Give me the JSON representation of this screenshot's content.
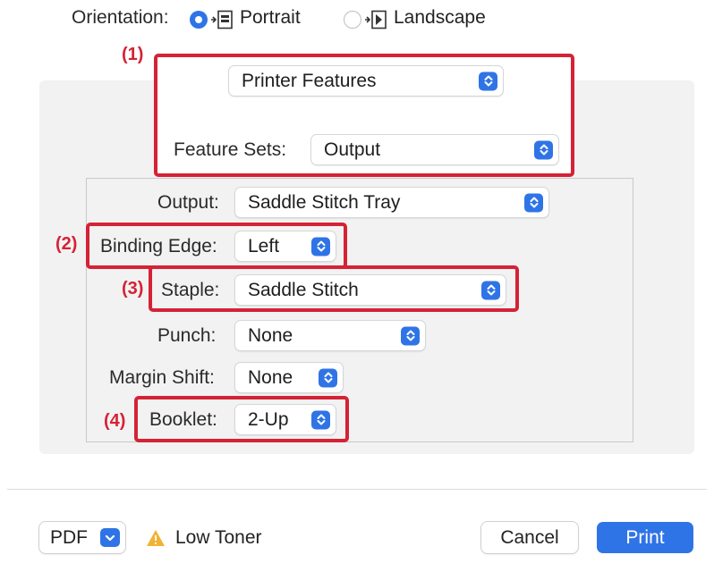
{
  "orientation": {
    "label": "Orientation:",
    "options": [
      {
        "label": "Portrait",
        "selected": true
      },
      {
        "label": "Landscape",
        "selected": false
      }
    ]
  },
  "panel_selector": {
    "value": "Printer Features"
  },
  "feature_sets": {
    "label": "Feature Sets:",
    "value": "Output"
  },
  "settings": {
    "output": {
      "label": "Output:",
      "value": "Saddle Stitch Tray"
    },
    "binding_edge": {
      "label": "Binding Edge:",
      "value": "Left"
    },
    "staple": {
      "label": "Staple:",
      "value": "Saddle Stitch"
    },
    "punch": {
      "label": "Punch:",
      "value": "None"
    },
    "margin_shift": {
      "label": "Margin Shift:",
      "value": "None"
    },
    "booklet": {
      "label": "Booklet:",
      "value": "2-Up"
    }
  },
  "annotations": [
    "(1)",
    "(2)",
    "(3)",
    "(4)"
  ],
  "footer": {
    "pdf_label": "PDF",
    "status": "Low Toner",
    "cancel_label": "Cancel",
    "print_label": "Print"
  },
  "colors": {
    "accent": "#2f74e6",
    "annotation": "#d52236",
    "panel_bg": "#f2f2f2",
    "warning": "#f2b233"
  }
}
